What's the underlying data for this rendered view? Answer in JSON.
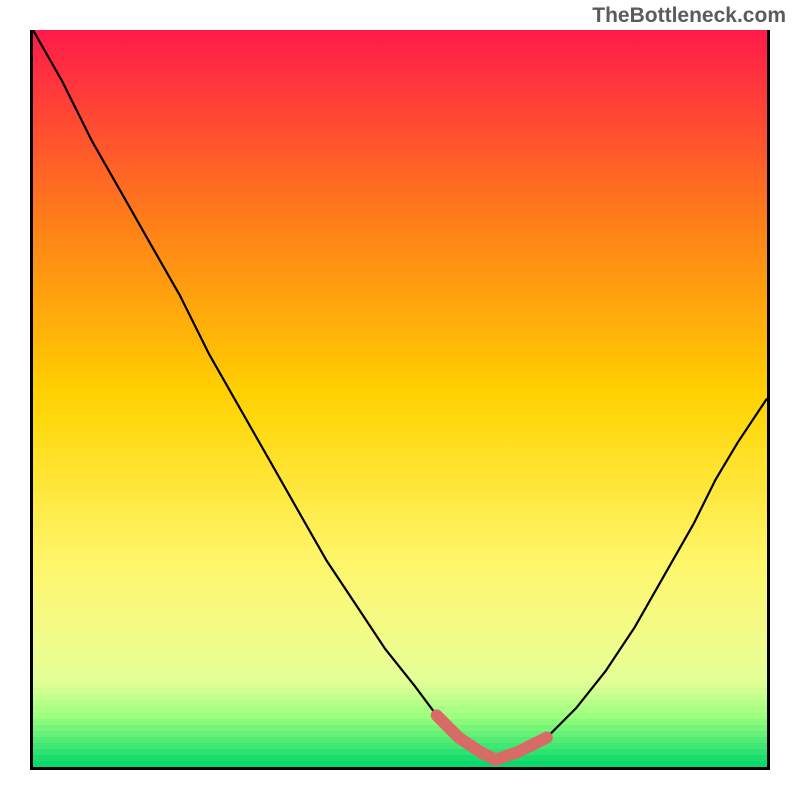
{
  "credit": "TheBottleneck.com",
  "colors": {
    "top": "#ff1a4a",
    "mid_upper": "#ff9a00",
    "mid": "#ffe100",
    "mid_lower": "#f9ff66",
    "low": "#d9ffb3",
    "green_band_start": "#9cff7e",
    "green_band_end": "#00d66b",
    "curve": "#000000",
    "highlight": "#d96b66",
    "border": "#000000",
    "credit_text": "#5b5b5b"
  },
  "chart_data": {
    "type": "line",
    "title": "",
    "xlabel": "",
    "ylabel": "",
    "xlim": [
      0,
      100
    ],
    "ylim": [
      0,
      100
    ],
    "series": [
      {
        "name": "bottleneck-curve",
        "x": [
          0,
          4,
          8,
          12,
          16,
          20,
          24,
          28,
          32,
          36,
          40,
          44,
          48,
          52,
          55,
          58,
          61,
          63,
          66,
          70,
          74,
          78,
          82,
          86,
          90,
          93,
          96,
          100
        ],
        "y": [
          100,
          93,
          85,
          78,
          71,
          64,
          56,
          49,
          42,
          35,
          28,
          22,
          16,
          11,
          7,
          4,
          2,
          1,
          2,
          4,
          8,
          13,
          19,
          26,
          33,
          39,
          44,
          50
        ]
      }
    ],
    "highlight_zone": {
      "name": "optimal-range",
      "x": [
        55,
        58,
        61,
        63,
        66,
        70
      ],
      "y": [
        7,
        4,
        2,
        1,
        2,
        4
      ]
    },
    "background_gradient_stops": [
      {
        "pct": 0.0,
        "color": "#ff1a4a"
      },
      {
        "pct": 0.25,
        "color": "#ff7a1a"
      },
      {
        "pct": 0.5,
        "color": "#ffd400"
      },
      {
        "pct": 0.72,
        "color": "#fff66b"
      },
      {
        "pct": 0.88,
        "color": "#eaff9a"
      },
      {
        "pct": 0.93,
        "color": "#9cff7e"
      },
      {
        "pct": 1.0,
        "color": "#00d66b"
      }
    ]
  }
}
